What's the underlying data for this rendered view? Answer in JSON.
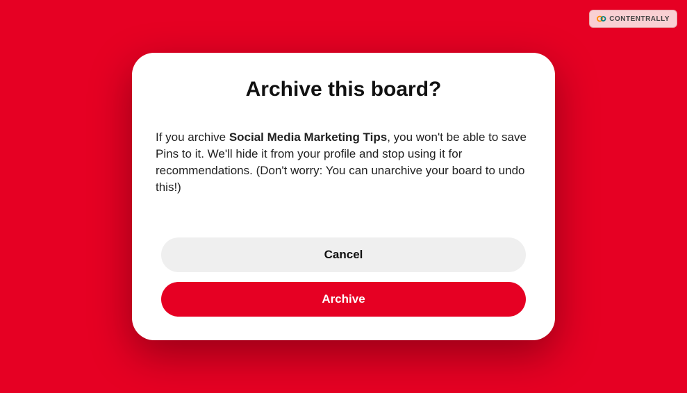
{
  "watermark": {
    "label": "CONTENTRALLY"
  },
  "modal": {
    "title": "Archive this board?",
    "body_before": "If you archive ",
    "board_name": "Social Media Marketing Tips",
    "body_after": ", you won't be able to save Pins to it. We'll hide it from your profile and stop using it for recommendations. (Don't worry: You can unarchive your board to undo this!)",
    "buttons": {
      "cancel": "Cancel",
      "archive": "Archive"
    }
  }
}
